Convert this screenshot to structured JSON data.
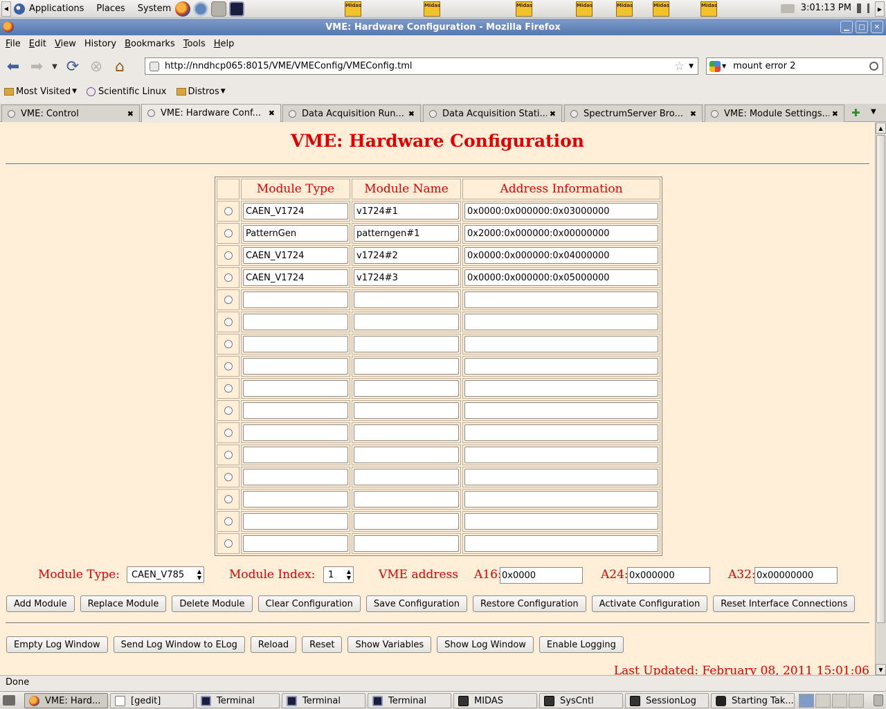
{
  "panel": {
    "menus": [
      "Applications",
      "Places",
      "System"
    ],
    "midas_icon_label": "Midas",
    "clock": "3:01:13 PM"
  },
  "window": {
    "title": "VME: Hardware Configuration - Mozilla Firefox"
  },
  "menubar": {
    "items": [
      {
        "first": "F",
        "rest": "ile"
      },
      {
        "first": "E",
        "rest": "dit"
      },
      {
        "first": "V",
        "rest": "iew"
      },
      {
        "first": "",
        "rest": "History",
        "ul_index": 1
      },
      {
        "first": "B",
        "rest": "ookmarks"
      },
      {
        "first": "T",
        "rest": "ools"
      },
      {
        "first": "H",
        "rest": "elp"
      }
    ]
  },
  "nav": {
    "url": "http://nndhcp065:8015/VME/VMEConfig/VMEConfig.tml",
    "search_value": "mount error 2"
  },
  "bookmarks": {
    "items": [
      "Most Visited",
      "Scientific Linux",
      "Distros"
    ]
  },
  "tabs": [
    {
      "label": "VME: Control",
      "active": false
    },
    {
      "label": "VME: Hardware Conf...",
      "active": true
    },
    {
      "label": "Data Acquisition Run...",
      "active": false
    },
    {
      "label": "Data Acquisition Stati...",
      "active": false
    },
    {
      "label": "SpectrumServer Bro...",
      "active": false
    },
    {
      "label": "VME: Module Settings...",
      "active": false
    }
  ],
  "page": {
    "title": "VME: Hardware Configuration",
    "table": {
      "headers": [
        "Module Type",
        "Module Name",
        "Address Information"
      ],
      "rows": [
        {
          "type": "CAEN_V1724",
          "name": "v1724#1",
          "addr": "0x0000:0x000000:0x03000000"
        },
        {
          "type": "PatternGen",
          "name": "patterngen#1",
          "addr": "0x2000:0x000000:0x00000000"
        },
        {
          "type": "CAEN_V1724",
          "name": "v1724#2",
          "addr": "0x0000:0x000000:0x04000000"
        },
        {
          "type": "CAEN_V1724",
          "name": "v1724#3",
          "addr": "0x0000:0x000000:0x05000000"
        },
        {
          "type": "",
          "name": "",
          "addr": ""
        },
        {
          "type": "",
          "name": "",
          "addr": ""
        },
        {
          "type": "",
          "name": "",
          "addr": ""
        },
        {
          "type": "",
          "name": "",
          "addr": ""
        },
        {
          "type": "",
          "name": "",
          "addr": ""
        },
        {
          "type": "",
          "name": "",
          "addr": ""
        },
        {
          "type": "",
          "name": "",
          "addr": ""
        },
        {
          "type": "",
          "name": "",
          "addr": ""
        },
        {
          "type": "",
          "name": "",
          "addr": ""
        },
        {
          "type": "",
          "name": "",
          "addr": ""
        },
        {
          "type": "",
          "name": "",
          "addr": ""
        },
        {
          "type": "",
          "name": "",
          "addr": ""
        }
      ]
    },
    "form": {
      "module_type_label": "Module Type:",
      "module_type_value": "CAEN_V785",
      "module_index_label": "Module Index:",
      "module_index_value": "1",
      "vme_address_label": "VME address",
      "a16_label": "A16:",
      "a16_value": "0x0000",
      "a24_label": "A24:",
      "a24_value": "0x000000",
      "a32_label": "A32:",
      "a32_value": "0x00000000"
    },
    "config_buttons": [
      "Add Module",
      "Replace Module",
      "Delete Module",
      "Clear Configuration",
      "Save Configuration",
      "Restore Configuration",
      "Activate Configuration",
      "Reset Interface Connections"
    ],
    "log_buttons": [
      "Empty Log Window",
      "Send Log Window to ELog",
      "Reload",
      "Reset",
      "Show Variables",
      "Show Log Window",
      "Enable Logging"
    ],
    "last_updated": "Last Updated: February 08, 2011 15:01:06"
  },
  "status": "Done",
  "taskbar": [
    {
      "label": "VME: Hard...",
      "icon": "firefox-icon",
      "active": true
    },
    {
      "label": "[gedit]",
      "icon": "gedit-icon",
      "active": false
    },
    {
      "label": "Terminal",
      "icon": "terminal-icon",
      "active": false
    },
    {
      "label": "Terminal",
      "icon": "terminal-icon",
      "active": false
    },
    {
      "label": "Terminal",
      "icon": "terminal-icon",
      "active": false
    },
    {
      "label": "MIDAS",
      "icon": "midas-icon",
      "active": false
    },
    {
      "label": "SysCntl",
      "icon": "syscntl-icon",
      "active": false
    },
    {
      "label": "SessionLog",
      "icon": "sessionlog-icon",
      "active": false
    },
    {
      "label": "Starting Tak...",
      "icon": "camera-icon",
      "active": false
    }
  ],
  "colors": {
    "heading": "#e00000",
    "page_background": "#ffeed8",
    "titlebar": "#5678b1"
  }
}
